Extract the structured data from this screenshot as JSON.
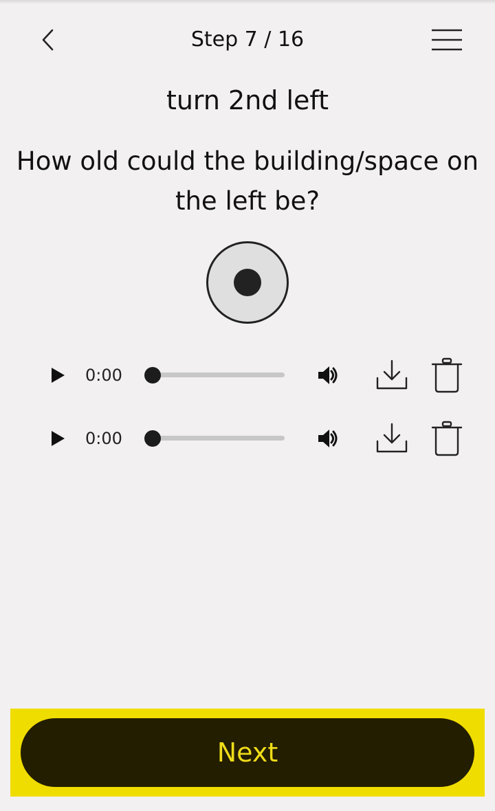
{
  "header": {
    "step_label": "Step 7 / 16",
    "back_icon": "chevron-left-icon",
    "menu_icon": "hamburger-menu-icon"
  },
  "instruction": "turn 2nd left",
  "question": "How old could the building/space on the left be?",
  "recorder": {
    "icon": "record-icon"
  },
  "recordings": [
    {
      "time": "0:00",
      "progress": 0,
      "play_icon": "play-icon",
      "volume_icon": "volume-icon",
      "download_icon": "download-icon",
      "delete_icon": "trash-icon"
    },
    {
      "time": "0:00",
      "progress": 0,
      "play_icon": "play-icon",
      "volume_icon": "volume-icon",
      "download_icon": "download-icon",
      "delete_icon": "trash-icon"
    }
  ],
  "footer": {
    "next_label": "Next"
  },
  "colors": {
    "background": "#f2f0f1",
    "footer_bar": "#f0dd00",
    "next_button": "#231e00",
    "next_text": "#efdc1a",
    "text": "#111111"
  }
}
